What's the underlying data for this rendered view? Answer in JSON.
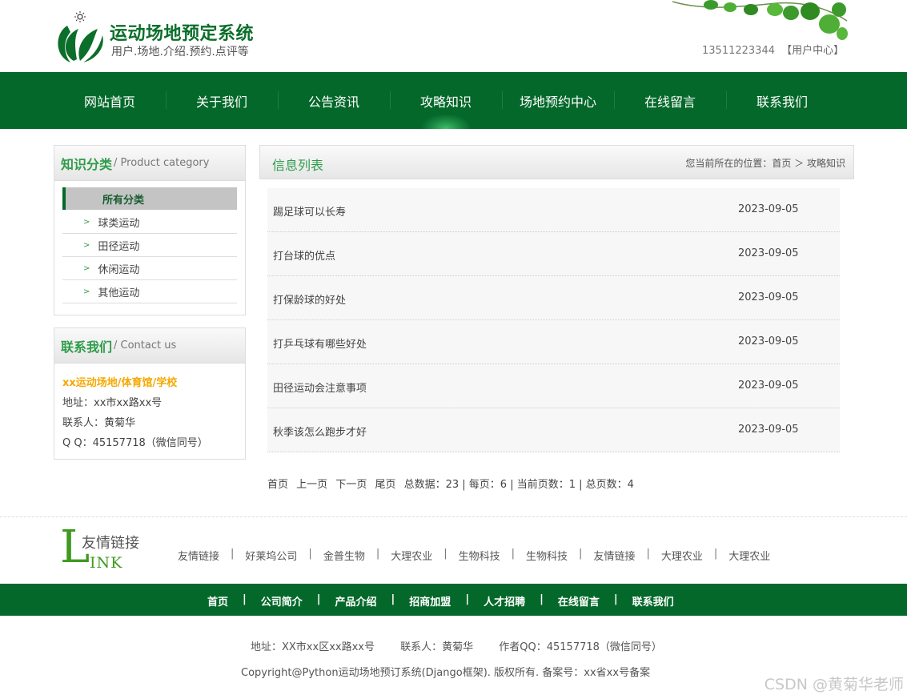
{
  "header": {
    "title": "运动场地预定系统",
    "subtitle": "用户.场地.介绍.预约.点评等",
    "phone": "13511223344",
    "user_center": "【用户中心】",
    "logo_icon": "leaf-logo-icon"
  },
  "nav": {
    "items": [
      "网站首页",
      "关于我们",
      "公告资讯",
      "攻略知识",
      "场地预约中心",
      "在线留言",
      "联系我们"
    ],
    "active_index": 3
  },
  "category": {
    "title": "知识分类",
    "title_en": "/ Product category",
    "active": "所有分类",
    "items": [
      "球类运动",
      "田径运动",
      "休闲运动",
      "其他运动"
    ]
  },
  "contact": {
    "title": "联系我们",
    "title_en": "/ Contact us",
    "org": "xx运动场地/体育馆/学校",
    "address": "地址：xx市xx路xx号",
    "person": "联系人：黄菊华",
    "qq": "Q Q：45157718（微信同号）"
  },
  "main": {
    "title": "信息列表",
    "breadcrumb": "您当前所在的位置：首页 ＞ 攻略知识",
    "rows": [
      {
        "title": "踢足球可以长寿",
        "date": "2023-09-05"
      },
      {
        "title": "打台球的优点",
        "date": "2023-09-05"
      },
      {
        "title": "打保龄球的好处",
        "date": "2023-09-05"
      },
      {
        "title": "打乒乓球有哪些好处",
        "date": "2023-09-05"
      },
      {
        "title": "田径运动会注意事项",
        "date": "2023-09-05"
      },
      {
        "title": "秋季该怎么跑步才好",
        "date": "2023-09-05"
      }
    ]
  },
  "pager": {
    "first": "首页",
    "prev": "上一页",
    "next": "下一页",
    "last": "尾页",
    "info": "总数据：23 | 每页：6 | 当前页数：1 | 总页数：4"
  },
  "links": {
    "logo_cn": "友情链接",
    "logo_big": "L",
    "logo_en": "INK",
    "items": [
      "友情链接",
      "好莱坞公司",
      "金普生物",
      "大理农业",
      "生物科技",
      "生物科技",
      "友情链接",
      "大理农业",
      "大理农业"
    ]
  },
  "footer_nav": [
    "首页",
    "公司简介",
    "产品介绍",
    "招商加盟",
    "人才招聘",
    "在线留言",
    "联系我们"
  ],
  "footer": {
    "address": "地址：XX市xx区xx路xx号",
    "person": "联系人：黄菊华",
    "qq": "作者QQ：45157718（微信同号）",
    "copyright": "Copyright@Python运动场地预订系统(Django框架). 版权所有. 备案号：xx省xx号备案",
    "watermark": "CSDN @黄菊华老师"
  },
  "colors": {
    "primary": "#04682a",
    "accent": "#2e9c4a",
    "highlight": "#f5a800"
  }
}
